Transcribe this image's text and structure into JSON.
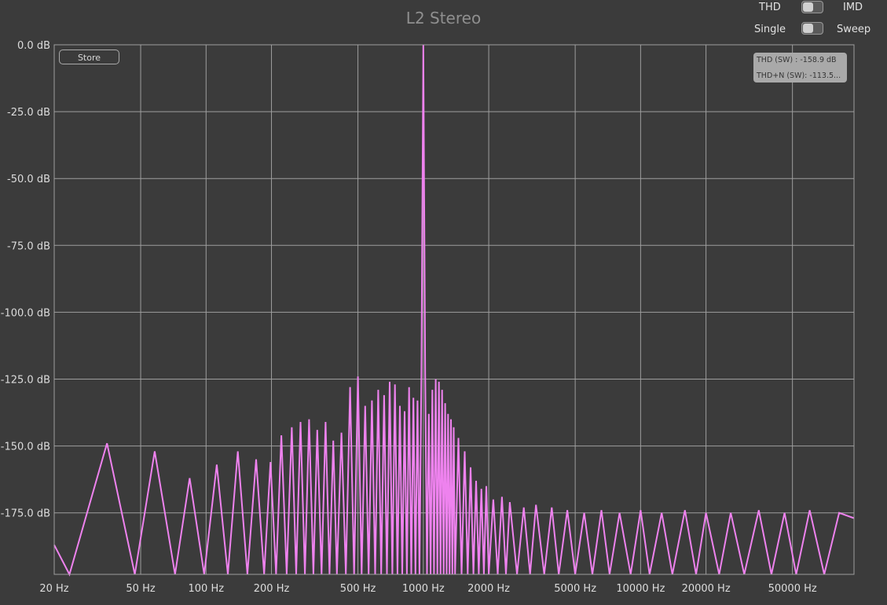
{
  "header": {
    "title": "L2 Stereo",
    "thd_label": "THD",
    "imd_label": "IMD",
    "single_label": "Single",
    "sweep_label": "Sweep"
  },
  "store_label": "Store",
  "readout": {
    "thd": "THD (SW) : -158.9 dB",
    "thdn": "THD+N (SW): -113.5..."
  },
  "colors": {
    "background": "#3b3b3b",
    "grid": "#9e9e9e",
    "trace": "#ee82ee"
  },
  "chart_data": {
    "type": "line",
    "title": "L2 Stereo",
    "x_scale": "log",
    "xlim": [
      20,
      96000
    ],
    "ylim": [
      -198,
      0
    ],
    "x_ticks": [
      20,
      50,
      100,
      200,
      500,
      1000,
      2000,
      5000,
      10000,
      20000,
      50000
    ],
    "x_tick_labels": [
      "20 Hz",
      "50 Hz",
      "100 Hz",
      "200 Hz",
      "500 Hz",
      "1000 Hz",
      "2000 Hz",
      "5000 Hz",
      "10000 Hz",
      "20000 Hz",
      "50000 Hz"
    ],
    "y_ticks": [
      0,
      -25,
      -50,
      -75,
      -100,
      -125,
      -150,
      -175
    ],
    "y_tick_labels": [
      "0.0 dB",
      "-25.0 dB",
      "-50.0 dB",
      "-75.0 dB",
      "-100.0 dB",
      "-125.0 dB",
      "-150.0 dB",
      "-175.0 dB"
    ],
    "grid": true,
    "series": [
      {
        "x": [
          20,
          23.5,
          35,
          47,
          58,
          72,
          84,
          98,
          112,
          126,
          140,
          155,
          170,
          185,
          198,
          210,
          222,
          235,
          248,
          260,
          272,
          285,
          298,
          312,
          325,
          340,
          355,
          370,
          385,
          400,
          420,
          440,
          460,
          480,
          500,
          520,
          540,
          560,
          580,
          600,
          620,
          640,
          660,
          680,
          700,
          720,
          740,
          760,
          780,
          800,
          820,
          840,
          860,
          880,
          900,
          920,
          940,
          960,
          980,
          1000,
          1020,
          1040,
          1060,
          1080,
          1100,
          1120,
          1140,
          1160,
          1180,
          1200,
          1220,
          1240,
          1260,
          1280,
          1300,
          1320,
          1340,
          1360,
          1380,
          1400,
          1450,
          1500,
          1550,
          1600,
          1650,
          1700,
          1750,
          1800,
          1850,
          1900,
          1950,
          2000,
          2100,
          2200,
          2300,
          2400,
          2500,
          2700,
          2900,
          3100,
          3300,
          3600,
          3900,
          4200,
          4600,
          5000,
          5500,
          6000,
          6600,
          7200,
          8000,
          9000,
          10000,
          11000,
          12500,
          14000,
          16000,
          18000,
          20000,
          23000,
          26000,
          30000,
          35000,
          40000,
          46000,
          52000,
          60000,
          70000,
          82000,
          96000
        ],
        "y": [
          -187,
          -198,
          -149,
          -198,
          -152,
          -198,
          -162,
          -198,
          -157,
          -198,
          -152,
          -198,
          -155,
          -198,
          -156,
          -198,
          -146,
          -198,
          -143,
          -198,
          -141,
          -198,
          -140,
          -198,
          -144,
          -198,
          -141,
          -198,
          -148,
          -198,
          -145,
          -198,
          -128,
          -198,
          -124,
          -198,
          -135,
          -198,
          -133,
          -198,
          -129,
          -198,
          -131,
          -198,
          -126,
          -198,
          -127,
          -198,
          -135,
          -198,
          -137,
          -198,
          -128,
          -198,
          -132,
          -198,
          -133,
          -198,
          -123,
          0,
          -123,
          -198,
          -138,
          -198,
          -129,
          -198,
          -125,
          -198,
          -126,
          -198,
          -129,
          -198,
          -134,
          -198,
          -138,
          -198,
          -140,
          -198,
          -143,
          -198,
          -147,
          -198,
          -152,
          -198,
          -158,
          -198,
          -163,
          -198,
          -166,
          -198,
          -165,
          -198,
          -170,
          -198,
          -169,
          -198,
          -171,
          -198,
          -173,
          -198,
          -172,
          -198,
          -173,
          -198,
          -174,
          -198,
          -175,
          -198,
          -174,
          -198,
          -175,
          -198,
          -174,
          -198,
          -175,
          -198,
          -174,
          -198,
          -175,
          -198,
          -175,
          -198,
          -174,
          -198,
          -175,
          -198,
          -174,
          -198,
          -175,
          -177
        ]
      }
    ]
  }
}
